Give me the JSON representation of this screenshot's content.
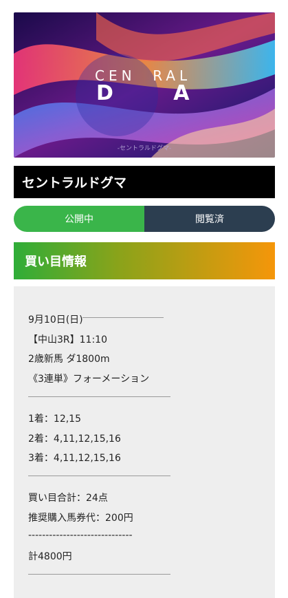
{
  "banner": {
    "logo_line1": "CEN  RAL",
    "logo_line2": "D   A",
    "subtitle": "-セントラルドグマ-"
  },
  "title": "セントラルドグマ",
  "status": {
    "open": "公開中",
    "read": "閲覧済"
  },
  "section_title": "買い目情報",
  "info": {
    "date": "9月10日(日)",
    "race": "【中山3R】11:10",
    "course": "2歳新馬 ダ1800m",
    "bet_type": "《3連単》フォーメーション",
    "first": "1着：12,15",
    "second": "2着：4,11,12,15,16",
    "third": "3着：4,11,12,15,16",
    "total_points": "買い目合計：24点",
    "recommended": "推奨購入馬券代：200円",
    "dashes": "------------------------------",
    "total": "計4800円"
  },
  "colors": {
    "green": "#3ab54a",
    "dark": "#2c3e50",
    "orange": "#f5960a"
  }
}
